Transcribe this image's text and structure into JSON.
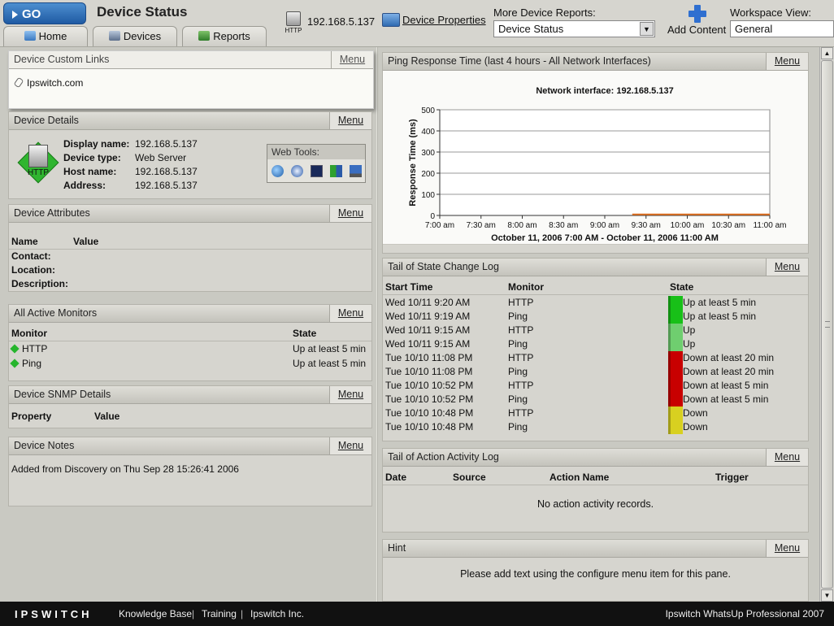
{
  "header": {
    "go_label": "GO",
    "title": "Device Status",
    "tabs": [
      {
        "label": "Home",
        "icon": "home-icon"
      },
      {
        "label": "Devices",
        "icon": "devices-icon"
      },
      {
        "label": "Reports",
        "icon": "reports-icon"
      }
    ],
    "device_badge": "HTTP",
    "device_address": "192.168.5.137",
    "device_properties_label": "Device Properties",
    "more_reports_label": "More Device Reports:",
    "more_reports_value": "Device Status",
    "add_content_label": "Add Content",
    "workspace_label": "Workspace View:",
    "workspace_value": "General"
  },
  "menu_label": "Menu",
  "custom_links": {
    "title": "Device Custom Links",
    "links": [
      "Ipswitch.com"
    ]
  },
  "device_details": {
    "title": "Device Details",
    "icon_label": "HTTP",
    "display_name_key": "Display name:",
    "display_name": "192.168.5.137",
    "device_type_key": "Device type:",
    "device_type": "Web Server",
    "host_name_key": "Host name:",
    "host_name": "192.168.5.137",
    "address_key": "Address:",
    "address": "192.168.5.137",
    "web_tools_label": "Web Tools:"
  },
  "device_attributes": {
    "title": "Device Attributes",
    "col_name": "Name",
    "col_value": "Value",
    "rows": [
      "Contact:",
      "Location:",
      "Description:"
    ]
  },
  "active_monitors": {
    "title": "All Active Monitors",
    "col_monitor": "Monitor",
    "col_state": "State",
    "rows": [
      {
        "monitor": "HTTP",
        "state": "Up at least 5 min"
      },
      {
        "monitor": "Ping",
        "state": "Up at least 5 min"
      }
    ]
  },
  "snmp_details": {
    "title": "Device SNMP Details",
    "col_property": "Property",
    "col_value": "Value"
  },
  "device_notes": {
    "title": "Device Notes",
    "text": "Added from Discovery on Thu Sep 28 15:26:41 2006"
  },
  "ping_chart": {
    "title": "Ping Response Time (last 4 hours - All Network Interfaces)"
  },
  "chart_data": {
    "type": "line",
    "title": "Network interface: 192.168.5.137",
    "ylabel": "Response Time (ms)",
    "xlabel": "October 11, 2006 7:00 AM - October 11, 2006 11:00 AM",
    "x_ticks": [
      "7:00 am",
      "7:30 am",
      "8:00 am",
      "8:30 am",
      "9:00 am",
      "9:30 am",
      "10:00 am",
      "10:30 am",
      "11:00 am"
    ],
    "y_ticks": [
      0,
      100,
      200,
      300,
      400,
      500
    ],
    "ylim": [
      0,
      500
    ],
    "grid": true,
    "series": [
      {
        "color": "#e07020",
        "x": [
          "9:20 am",
          "11:00 am"
        ],
        "values": [
          1,
          1
        ]
      }
    ]
  },
  "state_log": {
    "title": "Tail of State Change Log",
    "col_start": "Start Time",
    "col_monitor": "Monitor",
    "col_state": "State",
    "rows": [
      {
        "time": "Wed 10/11 9:20 AM",
        "monitor": "HTTP",
        "state": "Up at least 5 min",
        "color": "#18c018"
      },
      {
        "time": "Wed 10/11 9:19 AM",
        "monitor": "Ping",
        "state": "Up at least 5 min",
        "color": "#18c018"
      },
      {
        "time": "Wed 10/11 9:15 AM",
        "monitor": "HTTP",
        "state": "Up",
        "color": "#6fce6f"
      },
      {
        "time": "Wed 10/11 9:15 AM",
        "monitor": "Ping",
        "state": "Up",
        "color": "#6fce6f"
      },
      {
        "time": "Tue 10/10 11:08 PM",
        "monitor": "HTTP",
        "state": "Down at least 20 min",
        "color": "#c80000"
      },
      {
        "time": "Tue 10/10 11:08 PM",
        "monitor": "Ping",
        "state": "Down at least 20 min",
        "color": "#c80000"
      },
      {
        "time": "Tue 10/10 10:52 PM",
        "monitor": "HTTP",
        "state": "Down at least 5 min",
        "color": "#c80000"
      },
      {
        "time": "Tue 10/10 10:52 PM",
        "monitor": "Ping",
        "state": "Down at least 5 min",
        "color": "#c80000"
      },
      {
        "time": "Tue 10/10 10:48 PM",
        "monitor": "HTTP",
        "state": "Down",
        "color": "#d8d020"
      },
      {
        "time": "Tue 10/10 10:48 PM",
        "monitor": "Ping",
        "state": "Down",
        "color": "#d8d020"
      }
    ]
  },
  "action_log": {
    "title": "Tail of Action Activity Log",
    "col_date": "Date",
    "col_source": "Source",
    "col_action": "Action Name",
    "col_trigger": "Trigger",
    "empty_text": "No action activity records."
  },
  "hint": {
    "title": "Hint",
    "text": "Please add text using the configure menu item for this pane."
  },
  "footer": {
    "logo": "IPSWITCH",
    "links": [
      "Knowledge Base",
      "Training",
      "Ipswitch Inc."
    ],
    "separator": "|",
    "product": "Ipswitch WhatsUp Professional 2007"
  },
  "colors": {
    "accent": "#2f6bb1",
    "up": "#18c018",
    "down": "#c80000"
  }
}
